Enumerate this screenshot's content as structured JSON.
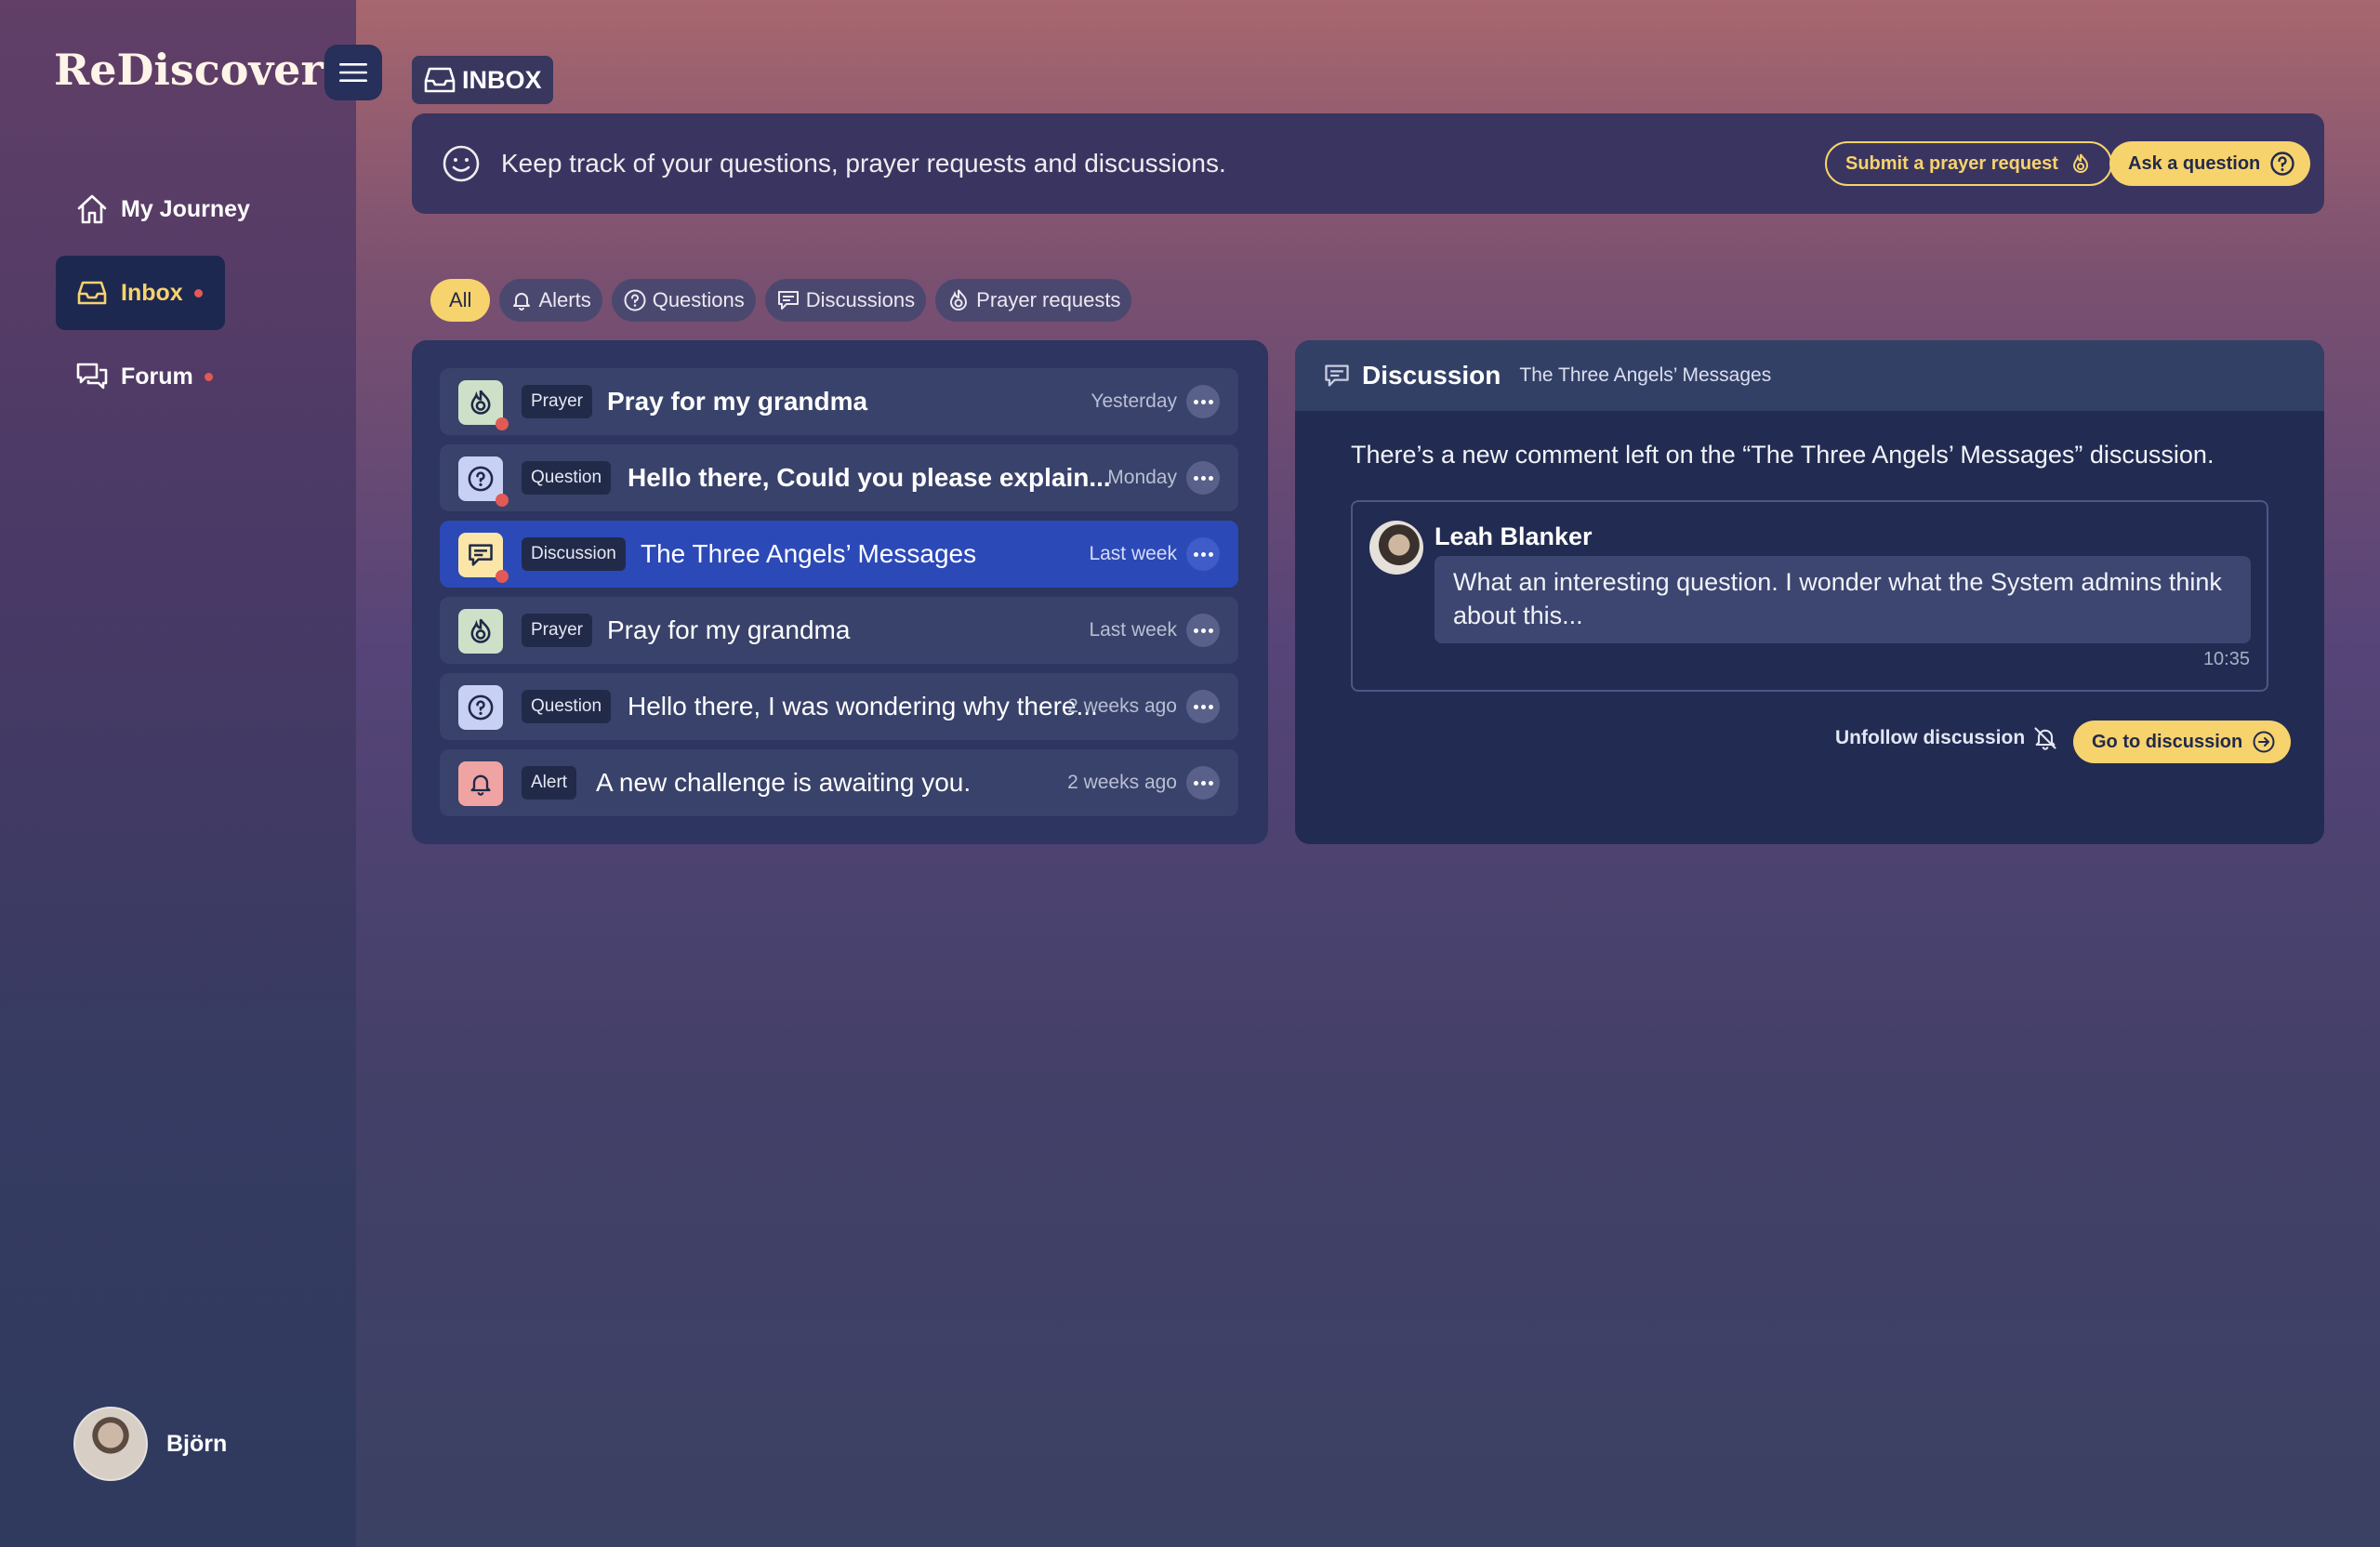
{
  "app": {
    "logo": "ReDiscover"
  },
  "sidebar": {
    "items": [
      {
        "label": "My Journey",
        "icon": "home-icon",
        "active": false,
        "unread": false
      },
      {
        "label": "Inbox",
        "icon": "inbox-icon",
        "active": true,
        "unread": true
      },
      {
        "label": "Forum",
        "icon": "forum-icon",
        "active": false,
        "unread": true
      }
    ],
    "user": {
      "name": "Björn"
    }
  },
  "header": {
    "title": "INBOX",
    "banner_text": "Keep track of your questions, prayer requests and discussions.",
    "submit_prayer_label": "Submit a prayer request",
    "ask_question_label": "Ask a question"
  },
  "filters": [
    {
      "label": "All",
      "icon": "",
      "active": true
    },
    {
      "label": "Alerts",
      "icon": "bell-icon",
      "active": false
    },
    {
      "label": "Questions",
      "icon": "question-icon",
      "active": false
    },
    {
      "label": "Discussions",
      "icon": "chat-icon",
      "active": false
    },
    {
      "label": "Prayer requests",
      "icon": "prayer-icon",
      "active": false
    }
  ],
  "messages": [
    {
      "type": "Prayer",
      "title": "Pray for my grandma",
      "time": "Yesterday",
      "unread": true,
      "bold": true,
      "selected": false
    },
    {
      "type": "Question",
      "title": "Hello there, Could you please explain...",
      "time": "Monday",
      "unread": true,
      "bold": true,
      "selected": false
    },
    {
      "type": "Discussion",
      "title": "The Three Angels’ Messages",
      "time": "Last week",
      "unread": true,
      "bold": false,
      "selected": true
    },
    {
      "type": "Prayer",
      "title": "Pray for my grandma",
      "time": "Last week",
      "unread": false,
      "bold": false,
      "selected": false
    },
    {
      "type": "Question",
      "title": "Hello there, I was wondering why there...",
      "time": "2 weeks ago",
      "unread": false,
      "bold": false,
      "selected": false
    },
    {
      "type": "Alert",
      "title": "A new challenge is awaiting you.",
      "time": "2 weeks ago",
      "unread": false,
      "bold": false,
      "selected": false
    }
  ],
  "detail": {
    "heading": "Discussion",
    "subheading": "The Three Angels’ Messages",
    "message": "There’s a new comment left on the “The Three Angels’ Messages” discussion.",
    "comment": {
      "author": "Leah Blanker",
      "text": "What an interesting question. I wonder what the System admins think about this...",
      "time": "10:35"
    },
    "unfollow_label": "Unfollow discussion",
    "goto_label": "Go to discussion"
  },
  "colors": {
    "accent": "#f7d36e",
    "selected_row": "#2c49b8",
    "unread_dot": "#e25a55",
    "panel": "#2d3560"
  }
}
